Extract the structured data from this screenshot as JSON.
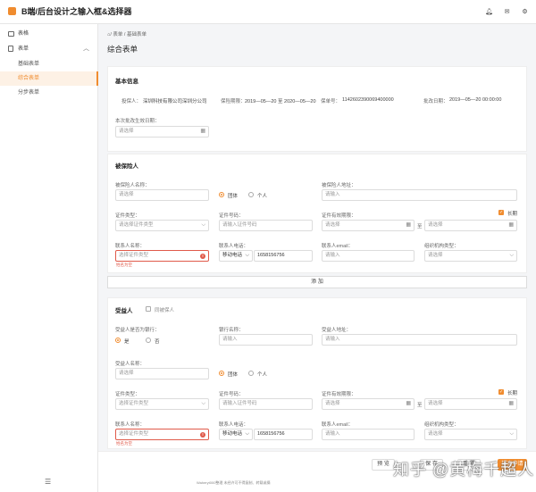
{
  "app": {
    "title": "B端/后台设计之输入框&选择器"
  },
  "sidebar": {
    "items": [
      {
        "label": "表格"
      },
      {
        "label": "表单"
      }
    ],
    "subitems": [
      {
        "label": "基础表单"
      },
      {
        "label": "综合表单"
      },
      {
        "label": "分步表单"
      }
    ]
  },
  "breadcrumb": {
    "text": "/ 表单 / 基础表单"
  },
  "page": {
    "title": "综合表单"
  },
  "basic": {
    "title": "基本信息",
    "insurer_label": "投保人：",
    "insurer_value": "深圳科技有限公司深圳分公司",
    "period_label": "保险期限：",
    "period_value": "2019—05—20 至 2020—05—20",
    "policy_label": "保单号：",
    "policy_value": "1142602390069400000",
    "approve_label": "批改日期：",
    "approve_value": "2019—05—20 00:00:00",
    "effective_label": "本次批改生效日期：",
    "effective_placeholder": "请选择"
  },
  "insured": {
    "title": "被保险人",
    "name_label": "被保险人名称：",
    "name_placeholder": "请选择",
    "group_label": "团体",
    "personal_label": "个人",
    "address_label": "被保险人地址：",
    "address_placeholder": "请输入",
    "idtype_label": "证件类型：",
    "idtype_placeholder": "请选择证件类型",
    "idno_label": "证件号码：",
    "idno_placeholder": "请输入证件号码",
    "idvalid_label": "证件有效期限：",
    "start_placeholder": "请选择",
    "to": "至",
    "end_placeholder": "请选择",
    "longterm_label": "长期",
    "contact_label": "联系人名称：",
    "contact_placeholder": "选择证件类型",
    "contact_error": "姓名为空",
    "phone_label": "联系人电话：",
    "phone_type": "移动电话",
    "phone_value": "1658156756",
    "email_label": "联系人email：",
    "email_placeholder": "请输入",
    "org_label": "组织机构类型：",
    "org_placeholder": "请选择"
  },
  "add": {
    "label": "添 加"
  },
  "beneficiary": {
    "title": "受益人",
    "same_label": "同被保人",
    "bank_q_label": "受益人是否为银行：",
    "yes": "是",
    "no": "否",
    "bank_label": "银行名称：",
    "bank_placeholder": "请输入",
    "address_label": "受益人地址：",
    "address_placeholder": "请输入",
    "name_label": "受益人名称：",
    "name_placeholder": "请选择",
    "group_label": "团体",
    "personal_label": "个人",
    "idtype_label": "证件类型：",
    "idtype_placeholder": "选择证件类型",
    "idno_label": "证件号码：",
    "idno_placeholder": "请输入证件号码",
    "idvalid_label": "证件有效期限：",
    "start_placeholder": "请选择",
    "to": "至",
    "end_placeholder": "请选择",
    "longterm_label": "长期",
    "contact_label": "联系人名称：",
    "contact_placeholder": "选择证件类型",
    "contact_error": "姓名为空",
    "phone_label": "联系人电话：",
    "phone_type": "移动电话",
    "phone_value": "1658156756",
    "email_label": "联系人email：",
    "email_placeholder": "请输入",
    "org_label": "组织机构类型：",
    "org_placeholder": "请选择"
  },
  "footer": {
    "preview": "预 览",
    "save": "保 存",
    "reset": "重 置",
    "submit": "提交申请",
    "copyright": "Waheryt000整理  未经许可不得复制、转载或摘",
    "watermark": "知乎 @黄梅千超人"
  },
  "colors": {
    "accent": "#f08c2f",
    "error": "#e05a4a"
  },
  "icons": [
    "bell-icon",
    "mail-icon",
    "settings-icon",
    "table-icon",
    "form-icon",
    "chevron-up-icon",
    "home-icon",
    "calendar-icon",
    "chevron-down-icon",
    "collapse-icon"
  ]
}
